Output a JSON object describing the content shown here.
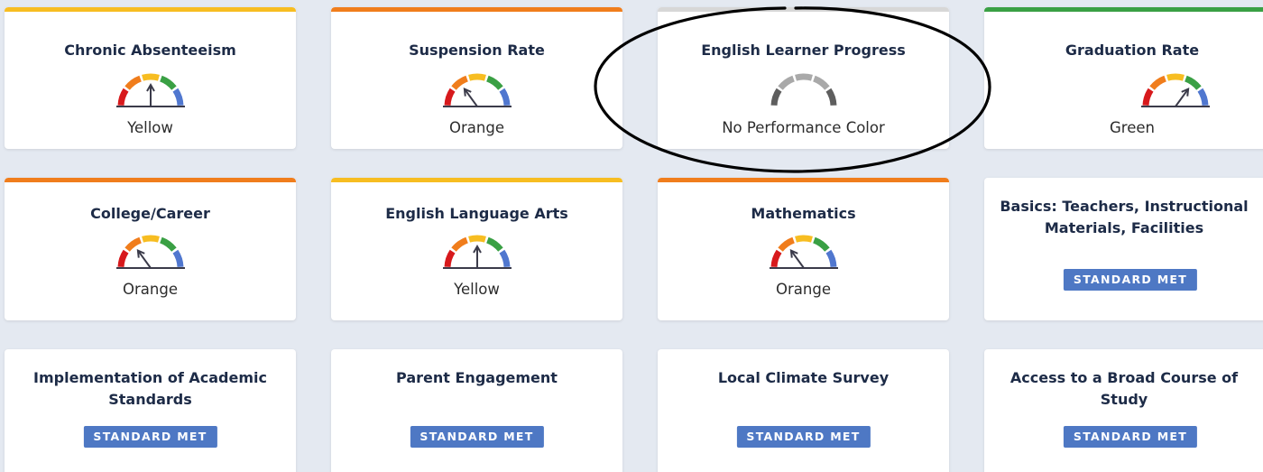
{
  "colors": {
    "red": "#d7191c",
    "orange": "#f07d1c",
    "yellow": "#f7bd21",
    "green": "#3aa044",
    "blue": "#5077cf",
    "gray_light": "#a9a9a9",
    "gray_dark": "#5e5e5e",
    "gray_bar": "#d7d7d7",
    "badge": "#4e78c4"
  },
  "row1": {
    "chronic_absenteeism": {
      "title": "Chronic Absenteeism",
      "status": "Yellow"
    },
    "suspension_rate": {
      "title": "Suspension Rate",
      "status": "Orange"
    },
    "english_learner_progress": {
      "title": "English Learner Progress",
      "status": "No Performance Color"
    },
    "graduation_rate": {
      "title": "Graduation Rate",
      "status": "Green"
    }
  },
  "row2": {
    "college_career": {
      "title": "College/Career",
      "status": "Orange"
    },
    "english_language_arts": {
      "title": "English Language Arts",
      "status": "Yellow"
    },
    "mathematics": {
      "title": "Mathematics",
      "status": "Orange"
    },
    "basics": {
      "title_line1": "Basics: Teachers, Instructional",
      "title_line2": "Materials, Facilities",
      "badge": "STANDARD MET"
    }
  },
  "row3": {
    "implementation": {
      "title_line1": "Implementation of Academic",
      "title_line2": "Standards",
      "badge": "STANDARD MET"
    },
    "parent_engagement": {
      "title": "Parent Engagement",
      "badge": "STANDARD MET"
    },
    "local_climate": {
      "title": "Local Climate Survey",
      "badge": "STANDARD MET"
    },
    "broad_course": {
      "title_line1": "Access to a Broad Course of",
      "title_line2": "Study",
      "badge": "STANDARD MET"
    }
  }
}
